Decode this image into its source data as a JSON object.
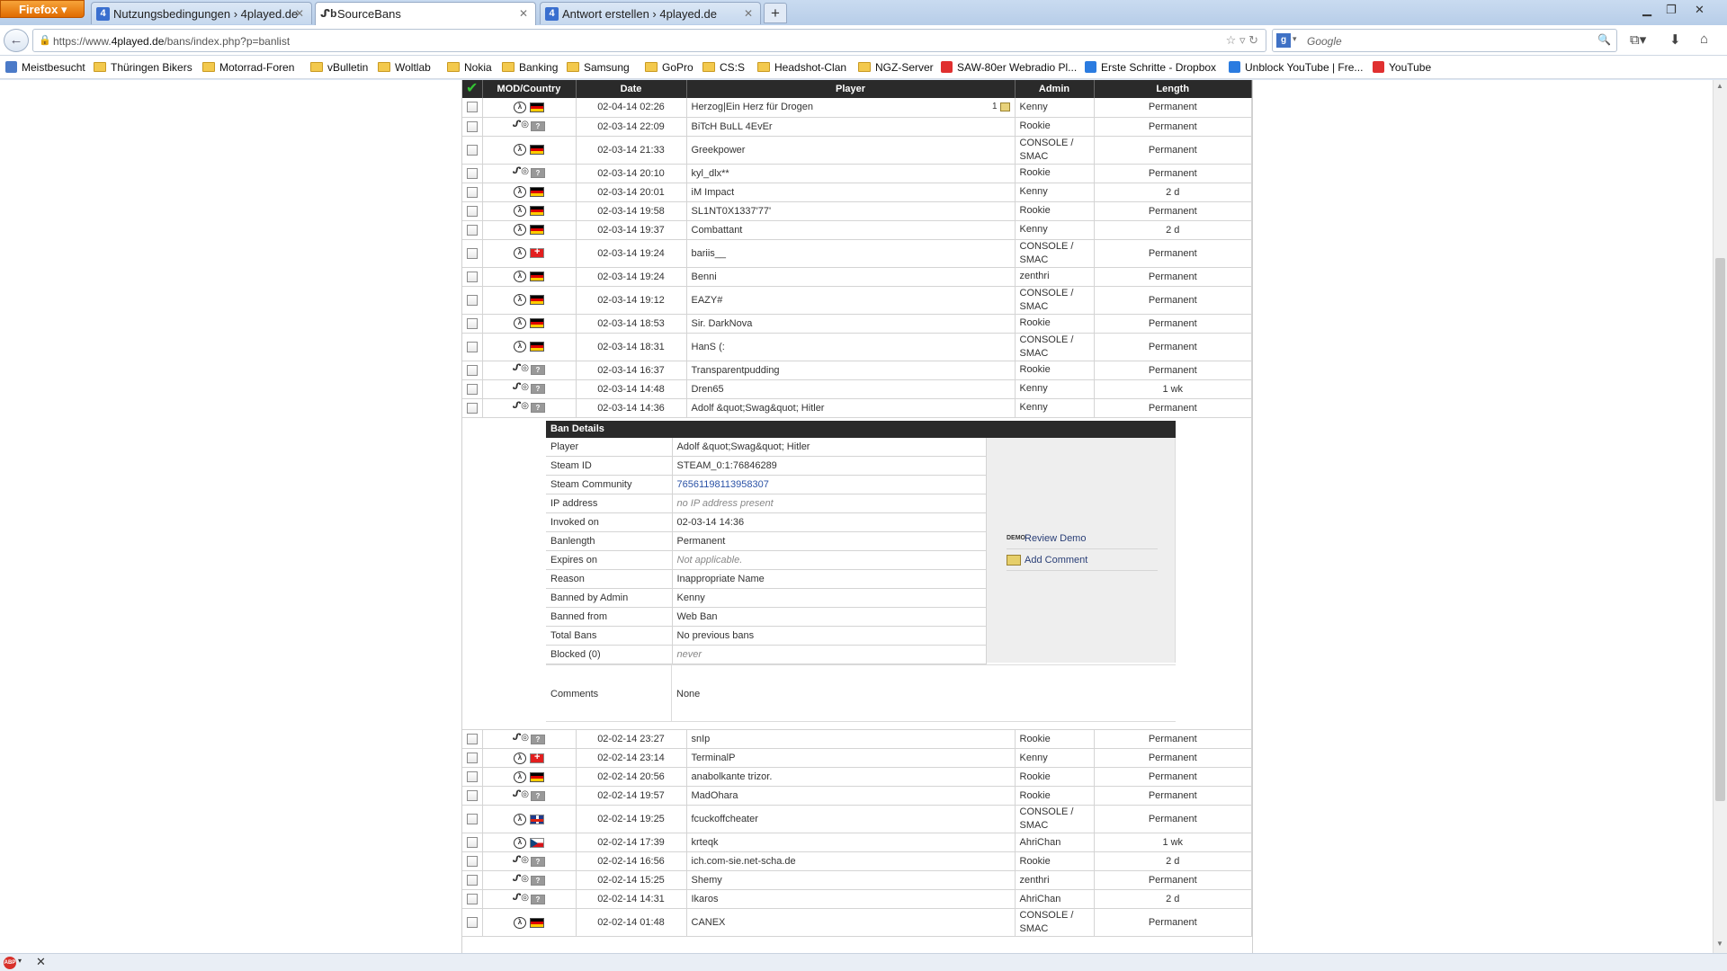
{
  "browser": {
    "menu_button": "Firefox",
    "tabs": [
      {
        "title": "Nutzungsbedingungen › 4played.de",
        "icon": "4"
      },
      {
        "title": "SourceBans",
        "icon": "sb"
      },
      {
        "title": "Antwort erstellen › 4played.de",
        "icon": "4"
      }
    ],
    "url_prefix": "https://www.",
    "url_host": "4played.de",
    "url_path": "/bans/index.php?p=banlist",
    "search_placeholder": "Google",
    "bookmarks": [
      {
        "label": "Meistbesucht",
        "kind": "site"
      },
      {
        "label": "Thüringen Bikers",
        "kind": "folder"
      },
      {
        "label": "Motorrad-Foren",
        "kind": "folder"
      },
      {
        "label": "vBulletin",
        "kind": "folder"
      },
      {
        "label": "Woltlab",
        "kind": "folder"
      },
      {
        "label": "Nokia",
        "kind": "folder"
      },
      {
        "label": "Banking",
        "kind": "folder"
      },
      {
        "label": "Samsung",
        "kind": "folder"
      },
      {
        "label": "GoPro",
        "kind": "folder"
      },
      {
        "label": "CS:S",
        "kind": "folder"
      },
      {
        "label": "Headshot-Clan",
        "kind": "folder"
      },
      {
        "label": "NGZ-Server",
        "kind": "folder"
      },
      {
        "label": "SAW-80er Webradio Pl...",
        "kind": "site-red"
      },
      {
        "label": "Erste Schritte - Dropbox",
        "kind": "site-blue"
      },
      {
        "label": "Unblock YouTube | Fre...",
        "kind": "site-blue"
      },
      {
        "label": "YouTube",
        "kind": "site-red"
      }
    ]
  },
  "table": {
    "headers": {
      "mod": "MOD/Country",
      "date": "Date",
      "player": "Player",
      "admin": "Admin",
      "length": "Length"
    },
    "rows_top": [
      {
        "mod": "hl",
        "flag": "de",
        "date": "02-04-14 02:26",
        "player": "Herzog|Ein Herz für Drogen",
        "comments": "1",
        "admin": "Kenny",
        "length": "Permanent"
      },
      {
        "mod": "src",
        "flag": "unk",
        "date": "02-03-14 22:09",
        "player": "BiTcH BuLL 4EvEr",
        "admin": "Rookie",
        "length": "Permanent"
      },
      {
        "mod": "hl",
        "flag": "de",
        "date": "02-03-14 21:33",
        "player": "Greekpower",
        "admin": "CONSOLE / SMAC",
        "length": "Permanent"
      },
      {
        "mod": "src",
        "flag": "unk",
        "date": "02-03-14 20:10",
        "player": "kyl_dlx**",
        "admin": "Rookie",
        "length": "Permanent"
      },
      {
        "mod": "hl",
        "flag": "de",
        "date": "02-03-14 20:01",
        "player": "iM Impact",
        "admin": "Kenny",
        "length": "2 d"
      },
      {
        "mod": "hl",
        "flag": "de",
        "date": "02-03-14 19:58",
        "player": "SL1NT0X1337'77'",
        "admin": "Rookie",
        "length": "Permanent"
      },
      {
        "mod": "hl",
        "flag": "de",
        "date": "02-03-14 19:37",
        "player": "Combattant",
        "admin": "Kenny",
        "length": "2 d"
      },
      {
        "mod": "hl",
        "flag": "ch",
        "date": "02-03-14 19:24",
        "player": "bariis__",
        "admin": "CONSOLE / SMAC",
        "length": "Permanent"
      },
      {
        "mod": "hl",
        "flag": "de",
        "date": "02-03-14 19:24",
        "player": "Benni",
        "admin": "zenthri",
        "length": "Permanent"
      },
      {
        "mod": "hl",
        "flag": "de",
        "date": "02-03-14 19:12",
        "player": "EAZY#",
        "admin": "CONSOLE / SMAC",
        "length": "Permanent"
      },
      {
        "mod": "hl",
        "flag": "de",
        "date": "02-03-14 18:53",
        "player": "Sir. DarkNova",
        "admin": "Rookie",
        "length": "Permanent"
      },
      {
        "mod": "hl",
        "flag": "de",
        "date": "02-03-14 18:31",
        "player": "HanS (:",
        "admin": "CONSOLE / SMAC",
        "length": "Permanent"
      },
      {
        "mod": "src",
        "flag": "unk",
        "date": "02-03-14 16:37",
        "player": "Transparentpudding",
        "admin": "Rookie",
        "length": "Permanent"
      },
      {
        "mod": "src",
        "flag": "unk",
        "date": "02-03-14 14:48",
        "player": "Dren65",
        "admin": "Kenny",
        "length": "1 wk"
      },
      {
        "mod": "src",
        "flag": "unk",
        "date": "02-03-14 14:36",
        "player": "Adolf &quot;Swag&quot; Hitler",
        "admin": "Kenny",
        "length": "Permanent"
      }
    ],
    "rows_bottom": [
      {
        "mod": "src",
        "flag": "unk",
        "date": "02-02-14 23:27",
        "player": "snIp",
        "admin": "Rookie",
        "length": "Permanent"
      },
      {
        "mod": "hl",
        "flag": "ch",
        "date": "02-02-14 23:14",
        "player": "TerminalP",
        "admin": "Kenny",
        "length": "Permanent"
      },
      {
        "mod": "hl",
        "flag": "de",
        "date": "02-02-14 20:56",
        "player": "anabolkante trizor.",
        "admin": "Rookie",
        "length": "Permanent"
      },
      {
        "mod": "src",
        "flag": "unk",
        "date": "02-02-14 19:57",
        "player": "MadOhara",
        "admin": "Rookie",
        "length": "Permanent"
      },
      {
        "mod": "hl",
        "flag": "gb",
        "date": "02-02-14 19:25",
        "player": "fcuckoffcheater",
        "admin": "CONSOLE / SMAC",
        "length": "Permanent"
      },
      {
        "mod": "hl",
        "flag": "cz",
        "date": "02-02-14 17:39",
        "player": "krteqk",
        "admin": "AhriChan",
        "length": "1 wk"
      },
      {
        "mod": "src",
        "flag": "unk",
        "date": "02-02-14 16:56",
        "player": "ich.com-sie.net-scha.de",
        "admin": "Rookie",
        "length": "2 d"
      },
      {
        "mod": "src",
        "flag": "unk",
        "date": "02-02-14 15:25",
        "player": "Shemy",
        "admin": "zenthri",
        "length": "Permanent"
      },
      {
        "mod": "src",
        "flag": "unk",
        "date": "02-02-14 14:31",
        "player": "Ikaros",
        "admin": "AhriChan",
        "length": "2 d"
      },
      {
        "mod": "hl",
        "flag": "de",
        "date": "02-02-14 01:48",
        "player": "CANEX",
        "admin": "CONSOLE / SMAC",
        "length": "Permanent"
      }
    ]
  },
  "details": {
    "title": "Ban Details",
    "fields": [
      {
        "key": "Player",
        "value": "Adolf &quot;Swag&quot; Hitler",
        "style": ""
      },
      {
        "key": "Steam ID",
        "value": "STEAM_0:1:76846289",
        "style": ""
      },
      {
        "key": "Steam Community",
        "value": "76561198113958307",
        "style": "lnk"
      },
      {
        "key": "IP address",
        "value": "no IP address present",
        "style": "i"
      },
      {
        "key": "Invoked on",
        "value": "02-03-14 14:36",
        "style": ""
      },
      {
        "key": "Banlength",
        "value": "Permanent",
        "style": ""
      },
      {
        "key": "Expires on",
        "value": "Not applicable.",
        "style": "i"
      },
      {
        "key": "Reason",
        "value": "Inappropriate Name",
        "style": ""
      },
      {
        "key": "Banned by Admin",
        "value": "Kenny",
        "style": ""
      },
      {
        "key": "Banned from",
        "value": "Web Ban",
        "style": ""
      },
      {
        "key": "Total Bans",
        "value": "No previous bans",
        "style": ""
      },
      {
        "key": "Blocked (0)",
        "value": "never",
        "style": "i"
      }
    ],
    "comments_label": "Comments",
    "comments_value": "None",
    "actions": {
      "review_demo": "Review Demo",
      "add_comment": "Add Comment"
    }
  }
}
